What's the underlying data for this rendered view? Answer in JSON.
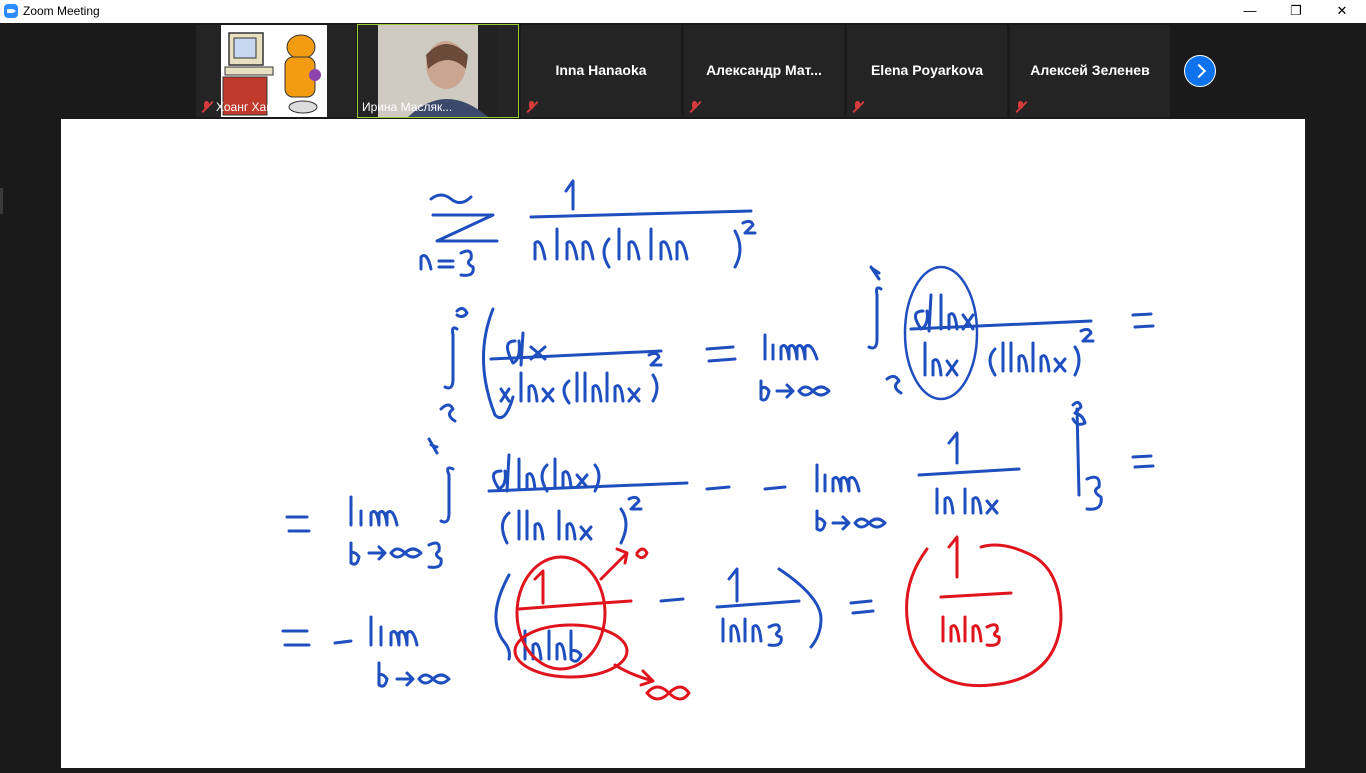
{
  "window": {
    "title": "Zoom Meeting",
    "minimize_label": "—",
    "maximize_label": "❐",
    "close_label": "✕"
  },
  "participants": [
    {
      "name": "Хоанг Хай",
      "muted": true,
      "video": true
    },
    {
      "name": "Ирина Масляк...",
      "muted": false,
      "video": true,
      "active_speaker": true
    },
    {
      "name": "Inna Hanaoka",
      "muted": true,
      "video": false
    },
    {
      "name": "Александр  Мат...",
      "muted": true,
      "video": false
    },
    {
      "name": "Elena Poyarkova",
      "muted": true,
      "video": false
    },
    {
      "name": "Алексей Зеленев",
      "muted": true,
      "video": false
    }
  ],
  "whiteboard": {
    "ink_colors": {
      "blue": "#1f4fbf",
      "red": "#e0141c"
    },
    "lines": [
      "Σ (n=3 → ∞) 1 / (n ln n (ln ln n)²)",
      "∫₃^∞ dx / (x ln x (ln ln x)²) = lim (b→∞) ∫₃^b d ln x / (ln x (ln ln x)²) =",
      "= lim (b→∞) ∫₃^b d ln(ln x) / (ln ln x)² = − lim (b→∞) 1 / ln ln x |₃^b =",
      "= − lim (b→∞) (1/ln ln b − 1/ln ln 3) = 1 / ln ln 3"
    ]
  }
}
